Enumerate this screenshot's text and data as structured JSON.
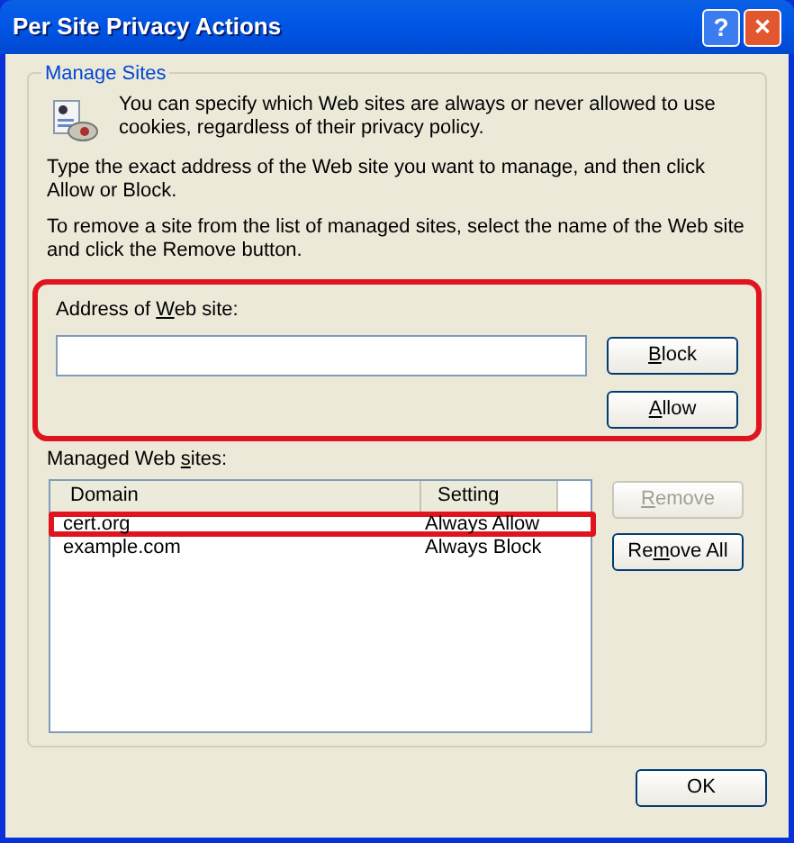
{
  "window": {
    "title": "Per Site Privacy Actions",
    "help_button": "?",
    "close_button": "✕"
  },
  "group": {
    "title": "Manage Sites",
    "intro": "You can specify which Web sites are always or never allowed to use cookies, regardless of their privacy policy.",
    "paragraphs": [
      "Type the exact address of the Web site you want to manage, and then click Allow or Block.",
      "To remove a site from the list of managed sites, select the name of the Web site and click the Remove button."
    ],
    "address": {
      "highlighted": true,
      "label": {
        "pre": "Address of ",
        "key": "W",
        "post": "eb site:"
      },
      "buttons": [
        {
          "key": "B",
          "post": "lock",
          "disabled": false
        },
        {
          "key": "A",
          "post": "llow",
          "disabled": false
        }
      ]
    },
    "managed": {
      "label": {
        "pre": "Managed Web ",
        "key": "s",
        "post": "ites:"
      },
      "columns": [
        "Domain",
        "Setting"
      ],
      "rows": [
        {
          "domain": "cert.org",
          "setting": "Always Allow",
          "highlighted": true
        },
        {
          "domain": "example.com",
          "setting": "Always Block",
          "highlighted": false
        }
      ],
      "buttons": [
        {
          "key": "R",
          "post": "emove",
          "disabled": true
        },
        {
          "pre": "Re",
          "key": "m",
          "post": "ove All",
          "disabled": false
        }
      ]
    }
  },
  "ok_button": "OK"
}
